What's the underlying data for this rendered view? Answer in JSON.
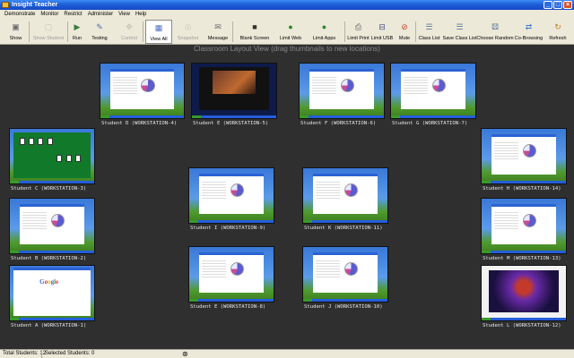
{
  "window": {
    "title": "Insight Teacher"
  },
  "menu": [
    "Demonstrate",
    "Monitor",
    "Restrict",
    "Administer",
    "View",
    "Help"
  ],
  "toolbar": {
    "buttons": [
      {
        "label": "Show",
        "icon": "show-icon",
        "color": "#6a6a6a",
        "glyph": "▣"
      },
      {
        "label": "Show Student",
        "icon": "show-student-icon",
        "color": "#9a9a9a",
        "glyph": "▢"
      },
      {
        "label": "Run",
        "icon": "run-icon",
        "color": "#3a7a3a",
        "glyph": "▶"
      },
      {
        "label": "Testing",
        "icon": "testing-icon",
        "color": "#5a6ab0",
        "glyph": "✎"
      },
      {
        "label": "Control",
        "icon": "control-icon",
        "color": "#9a9a9a",
        "glyph": "✥"
      },
      {
        "label": "View All",
        "icon": "view-all-icon",
        "color": "#4a6fc8",
        "glyph": "▦"
      },
      {
        "label": "Snapshot",
        "icon": "snapshot-icon",
        "color": "#9a9a9a",
        "glyph": "◎"
      },
      {
        "label": "Message",
        "icon": "message-icon",
        "color": "#6a6a6a",
        "glyph": "✉"
      },
      {
        "label": "Blank Screen",
        "icon": "blank-screen-icon",
        "color": "#333333",
        "glyph": "■"
      },
      {
        "label": "Limit Web",
        "icon": "limit-web-icon",
        "color": "#2a8a2a",
        "glyph": "●"
      },
      {
        "label": "Limit Apps",
        "icon": "limit-apps-icon",
        "color": "#2a8a2a",
        "glyph": "●"
      },
      {
        "label": "Limit Print",
        "icon": "limit-print-icon",
        "color": "#555555",
        "glyph": "⎙"
      },
      {
        "label": "Limit USB",
        "icon": "limit-usb-icon",
        "color": "#4a4a8a",
        "glyph": "⊟"
      },
      {
        "label": "Mute",
        "icon": "mute-icon",
        "color": "#c83a2a",
        "glyph": "⊘"
      },
      {
        "label": "Class List",
        "icon": "class-list-icon",
        "color": "#5a7a9a",
        "glyph": "☰"
      },
      {
        "label": "Save Class List",
        "icon": "save-class-list-icon",
        "color": "#5a7a9a",
        "glyph": "☰"
      },
      {
        "label": "Choose Random",
        "icon": "choose-random-icon",
        "color": "#5a7a9a",
        "glyph": "⚄"
      },
      {
        "label": "Co-Browsing",
        "icon": "co-browsing-icon",
        "color": "#3a7ac8",
        "glyph": "⇄"
      },
      {
        "label": "Refresh",
        "icon": "refresh-icon",
        "color": "#d07a20",
        "glyph": "↻"
      }
    ]
  },
  "layout_title": "Classroom Layout View (drag thumbnails to new locations)",
  "students": [
    {
      "label": "Student D (WORKSTATION-4)",
      "screen": "spreadsheet"
    },
    {
      "label": "Student E (WORKSTATION-5)",
      "screen": "media"
    },
    {
      "label": "Student F (WORKSTATION-6)",
      "screen": "spreadsheet"
    },
    {
      "label": "Student G (WORKSTATION-7)",
      "screen": "spreadsheet"
    },
    {
      "label": "Student C (WORKSTATION-3)",
      "screen": "solitaire"
    },
    {
      "label": "Student H (WORKSTATION-14)",
      "screen": "spreadsheet"
    },
    {
      "label": "Student I (WORKSTATION-9)",
      "screen": "spreadsheet"
    },
    {
      "label": "Student K (WORKSTATION-11)",
      "screen": "spreadsheet"
    },
    {
      "label": "Student B (WORKSTATION-2)",
      "screen": "spreadsheet"
    },
    {
      "label": "Student M (WORKSTATION-13)",
      "screen": "spreadsheet"
    },
    {
      "label": "Student E (WORKSTATION-8)",
      "screen": "spreadsheet"
    },
    {
      "label": "Student J (WORKSTATION-10)",
      "screen": "spreadsheet"
    },
    {
      "label": "Student A (WORKSTATION-1)",
      "screen": "web",
      "logo_text": "Google"
    },
    {
      "label": "Student L (WORKSTATION-12)",
      "screen": "art"
    }
  ],
  "status": {
    "total": "Total Students: 12",
    "selected": "Selected Students: 0"
  }
}
